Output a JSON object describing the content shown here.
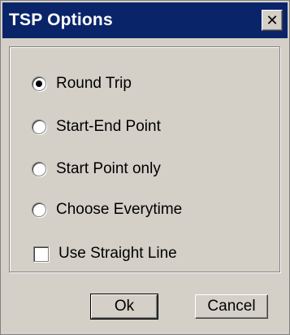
{
  "window": {
    "title": "TSP Options",
    "close_glyph": "✕"
  },
  "options": [
    {
      "label": "Round Trip",
      "checked": true
    },
    {
      "label": "Start-End Point",
      "checked": false
    },
    {
      "label": "Start Point only",
      "checked": false
    },
    {
      "label": "Choose Everytime",
      "checked": false
    }
  ],
  "straight_line": {
    "label": "Use Straight Line",
    "checked": false
  },
  "buttons": {
    "ok": "Ok",
    "cancel": "Cancel"
  },
  "colors": {
    "titlebar": "#0a246a",
    "face": "#d4d0c8"
  }
}
